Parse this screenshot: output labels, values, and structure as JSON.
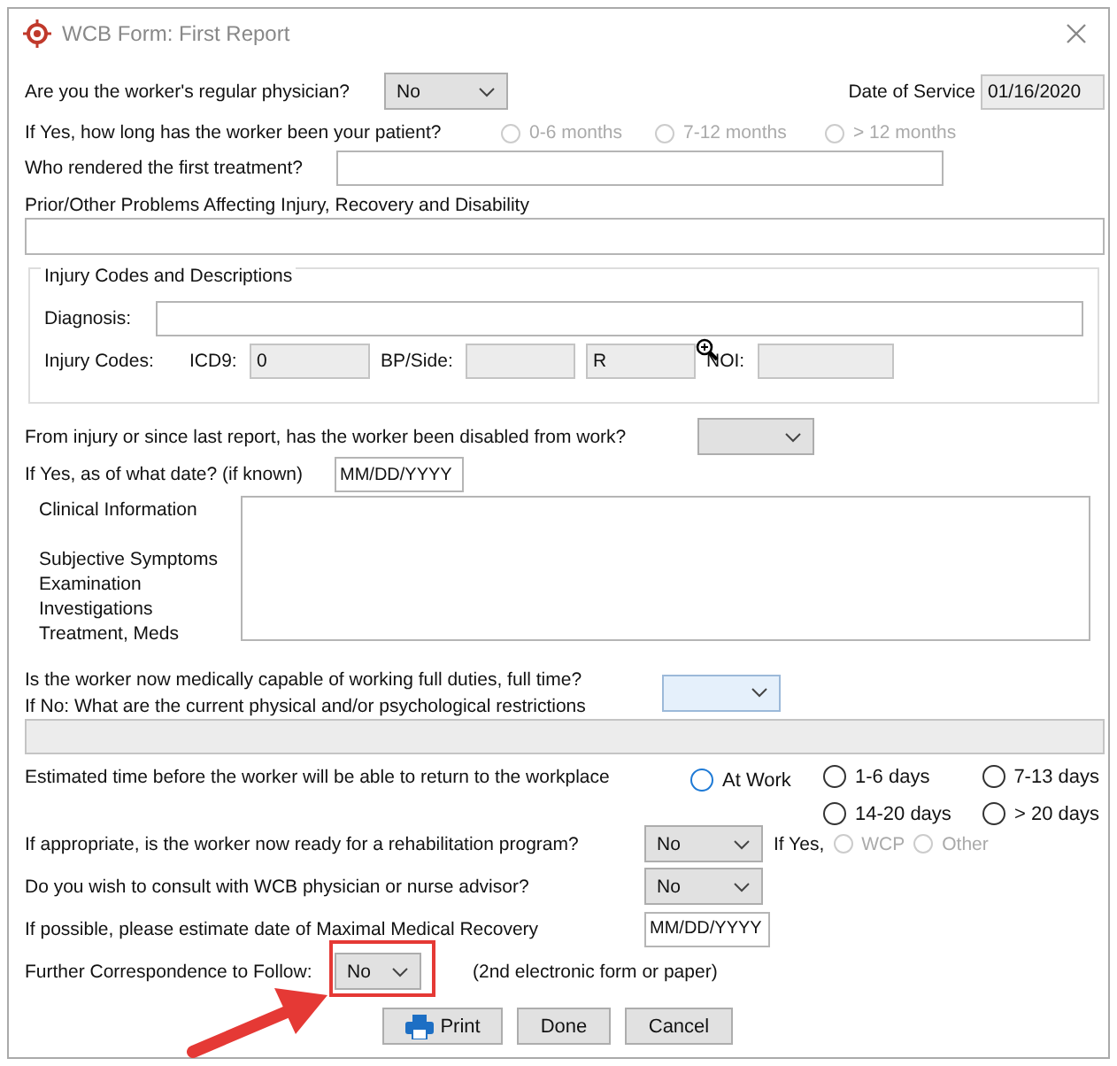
{
  "window": {
    "title": "WCB Form: First Report"
  },
  "regular_physician": {
    "label": "Are you the worker's regular physician?",
    "value": "No"
  },
  "date_of_service": {
    "label": "Date of Service",
    "value": "01/16/2020"
  },
  "patient_duration": {
    "label": "If Yes, how long has the worker been your patient?",
    "options": [
      {
        "label": "0-6 months",
        "selected": false,
        "disabled": true
      },
      {
        "label": "7-12 months",
        "selected": false,
        "disabled": true
      },
      {
        "label": "> 12 months",
        "selected": false,
        "disabled": true
      }
    ]
  },
  "first_treatment": {
    "label": "Who rendered the first treatment?"
  },
  "prior_problems": {
    "label": "Prior/Other Problems Affecting Injury, Recovery and Disability"
  },
  "injury_codes": {
    "title": "Injury Codes and Descriptions",
    "diagnosis_label": "Diagnosis:",
    "codes_label": "Injury Codes:",
    "icd9_label": "ICD9:",
    "icd9_value": "0",
    "bp_side_label": "BP/Side:",
    "side_value": "R",
    "noi_label": "NOI:"
  },
  "disabled_from_work": {
    "label": "From injury or since last report, has the worker been disabled from work?"
  },
  "disabled_date": {
    "label": "If Yes, as of what date? (if known)",
    "value": "MM/DD/YYYY"
  },
  "clinical": {
    "title": "Clinical Information",
    "labels": [
      "Subjective Symptoms",
      "Examination",
      "Investigations",
      "Treatment, Meds"
    ]
  },
  "capable": {
    "label": "Is the worker now medically capable of working full duties, full time?",
    "restrictions_label": "If No: What are the current physical and/or psychological restrictions"
  },
  "return_time": {
    "label": "Estimated time before the worker will be able to return to the workplace",
    "options": [
      {
        "label": "At Work",
        "selected": false,
        "focused": true
      },
      {
        "label": "1-6 days",
        "selected": false,
        "focused": false
      },
      {
        "label": "7-13 days",
        "selected": false,
        "focused": false
      },
      {
        "label": "14-20 days",
        "selected": false,
        "focused": false
      },
      {
        "label": "> 20 days",
        "selected": false,
        "focused": false
      }
    ]
  },
  "rehab": {
    "label": "If appropriate, is the worker now ready for a rehabilitation program?",
    "value": "No",
    "if_yes": "If Yes,",
    "options": [
      {
        "label": "WCP",
        "selected": false,
        "disabled": true
      },
      {
        "label": "Other",
        "selected": false,
        "disabled": true
      }
    ]
  },
  "consult": {
    "label": "Do you wish to consult with WCB physician or nurse advisor?",
    "value": "No"
  },
  "recovery_date": {
    "label": "If possible, please estimate date of Maximal Medical Recovery",
    "value": "MM/DD/YYYY"
  },
  "further": {
    "label": "Further Correspondence to Follow:",
    "value": "No",
    "note": "(2nd electronic form or paper)"
  },
  "buttons": [
    {
      "label": "Print",
      "kind": "print"
    },
    {
      "label": "Done",
      "kind": "plain"
    },
    {
      "label": "Cancel",
      "kind": "plain"
    }
  ]
}
